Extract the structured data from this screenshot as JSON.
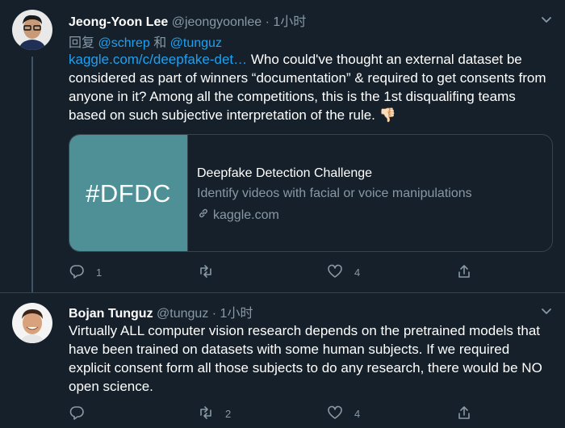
{
  "tweets": [
    {
      "name": "Jeong-Yoon Lee",
      "handle": "@jeongyoonlee",
      "dot": "·",
      "time": "1小时",
      "replying_prefix": "回复",
      "replying_to_1": "@schrep",
      "replying_and": "和",
      "replying_to_2": "@tunguz",
      "link_text": "kaggle.com/c/deepfake-det…",
      "text": " Who could've thought an external dataset be considered as part of winners “documentation” & required to get consents from anyone in it? Among all the competitions, this is the 1st disqualifing teams based on such subjective interpretation of the rule. 👎🏻",
      "card": {
        "image_text": "#DFDC",
        "title": "Deepfake Detection Challenge",
        "description": "Identify videos with facial or voice manipulations",
        "domain": "kaggle.com"
      },
      "actions": {
        "reply_count": "1",
        "retweet_count": "",
        "like_count": "4"
      }
    },
    {
      "name": "Bojan Tunguz",
      "handle": "@tunguz",
      "dot": "·",
      "time": "1小时",
      "text": "Virtually ALL computer vision research depends on the pretrained models that have been trained on datasets with some human subjects. If we required explicit consent form all those subjects to do any research, there would be NO open science.",
      "actions": {
        "reply_count": "",
        "retweet_count": "2",
        "like_count": "4"
      }
    }
  ],
  "icons": [
    "chevron-down-icon",
    "reply-icon",
    "retweet-icon",
    "like-icon",
    "share-icon",
    "link-icon"
  ],
  "colors": {
    "background": "#15202b",
    "link": "#1da1f2",
    "muted": "#8899a6",
    "card_image": "#4f8f96"
  }
}
